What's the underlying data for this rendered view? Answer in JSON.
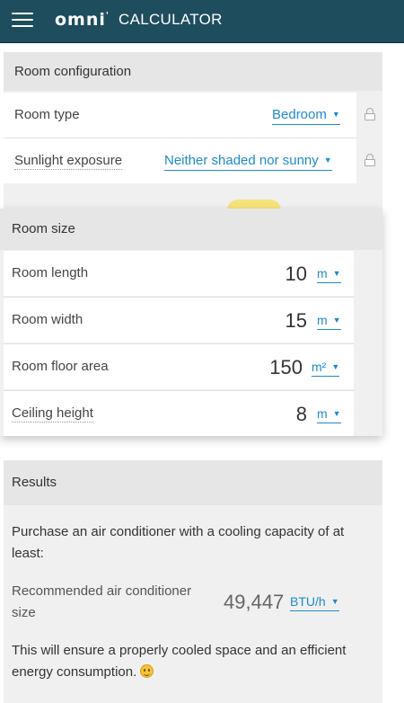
{
  "header": {
    "logo": "omni",
    "logo_mark": "'",
    "logo_sub": "CALCULATOR"
  },
  "room_config": {
    "title": "Room configuration",
    "room_type_label": "Room type",
    "room_type_value": "Bedroom",
    "sunlight_label": "Sunlight exposure",
    "sunlight_value": "Neither shaded nor sunny"
  },
  "room_size": {
    "title": "Room size",
    "length_label": "Room length",
    "length_value": "10",
    "length_unit": "m",
    "width_label": "Room width",
    "width_value": "15",
    "width_unit": "m",
    "area_label": "Room floor area",
    "area_value": "150",
    "area_unit": "m²",
    "ceiling_label": "Ceiling height",
    "ceiling_value": "8",
    "ceiling_unit": "m"
  },
  "results": {
    "title": "Results",
    "intro": "Purchase an air conditioner with a cooling capacity of at least:",
    "recommended_label": "Recommended air conditioner size",
    "recommended_value": "49,447",
    "recommended_unit": "BTU/h",
    "outro": "This will ensure a properly cooled space and an efficient energy consumption."
  },
  "icons": {
    "menu": "hamburger-icon",
    "lock": "lock-icon",
    "caret": "caret-down-icon",
    "emoji": "smiley-icon"
  }
}
